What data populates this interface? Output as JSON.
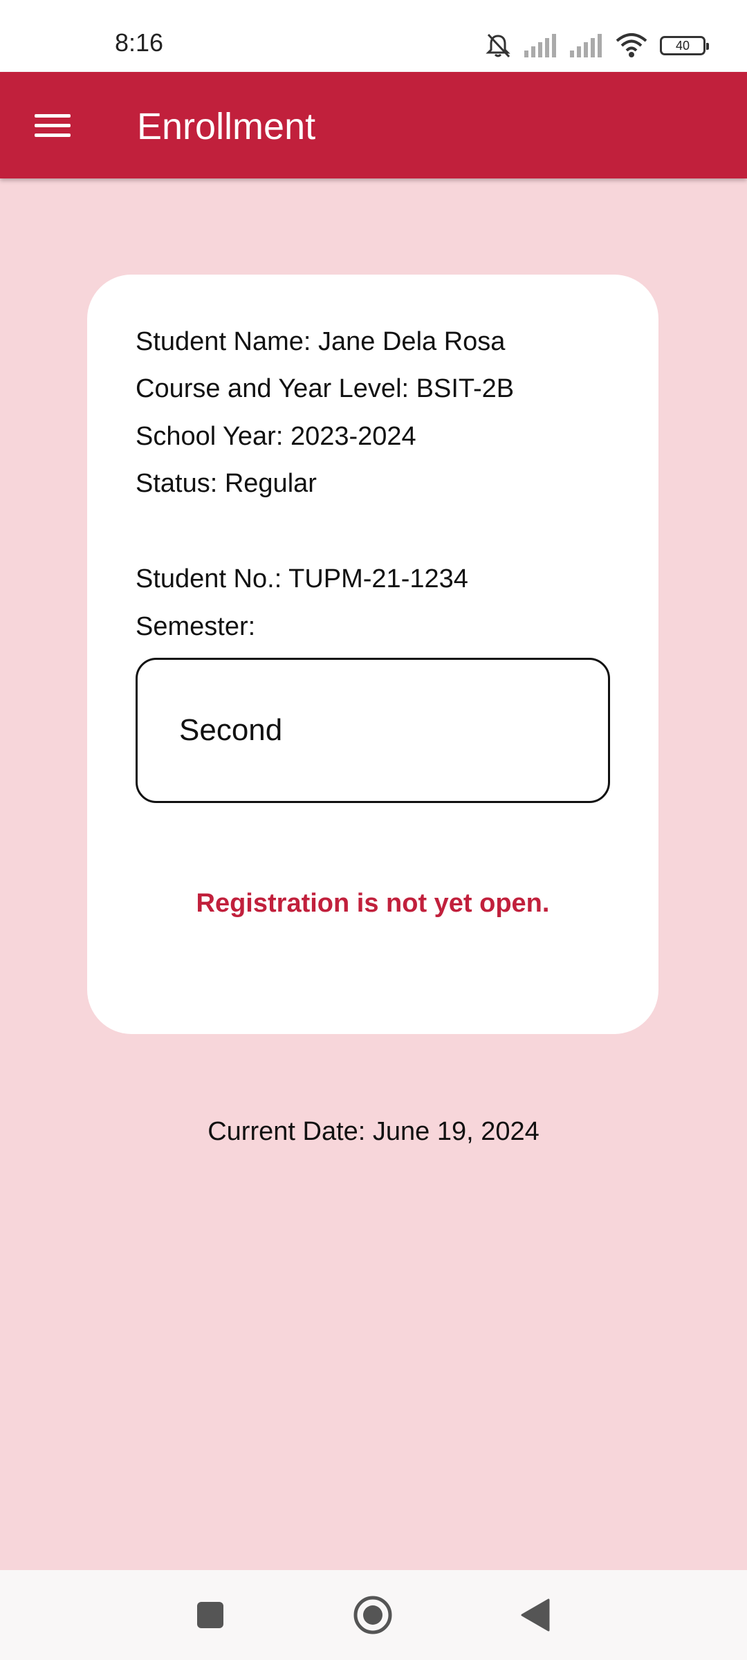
{
  "status_bar": {
    "time": "8:16",
    "battery": "40",
    "icons": [
      "bell-off-icon",
      "signal-icon",
      "signal-icon",
      "wifi-icon",
      "battery-icon"
    ]
  },
  "app_bar": {
    "title": "Enrollment",
    "menu_icon": "hamburger-menu-icon"
  },
  "card": {
    "student_name": "Student Name: Jane Dela Rosa",
    "course_year": "Course and Year Level: BSIT-2B",
    "school_year": "School Year: 2023-2024",
    "status": "Status: Regular",
    "student_no": "Student No.: TUPM-21-1234",
    "semester_label": "Semester:",
    "semester_value": "Second",
    "registration_message": "Registration is not yet open."
  },
  "current_date": "Current Date: June 19, 2024",
  "colors": {
    "primary": "#c1203c",
    "background": "#f7d6da",
    "card": "#ffffff",
    "message": "#c1203c"
  },
  "nav_bar": {
    "icons": [
      "recents-square-icon",
      "home-circle-icon",
      "back-triangle-icon"
    ]
  }
}
